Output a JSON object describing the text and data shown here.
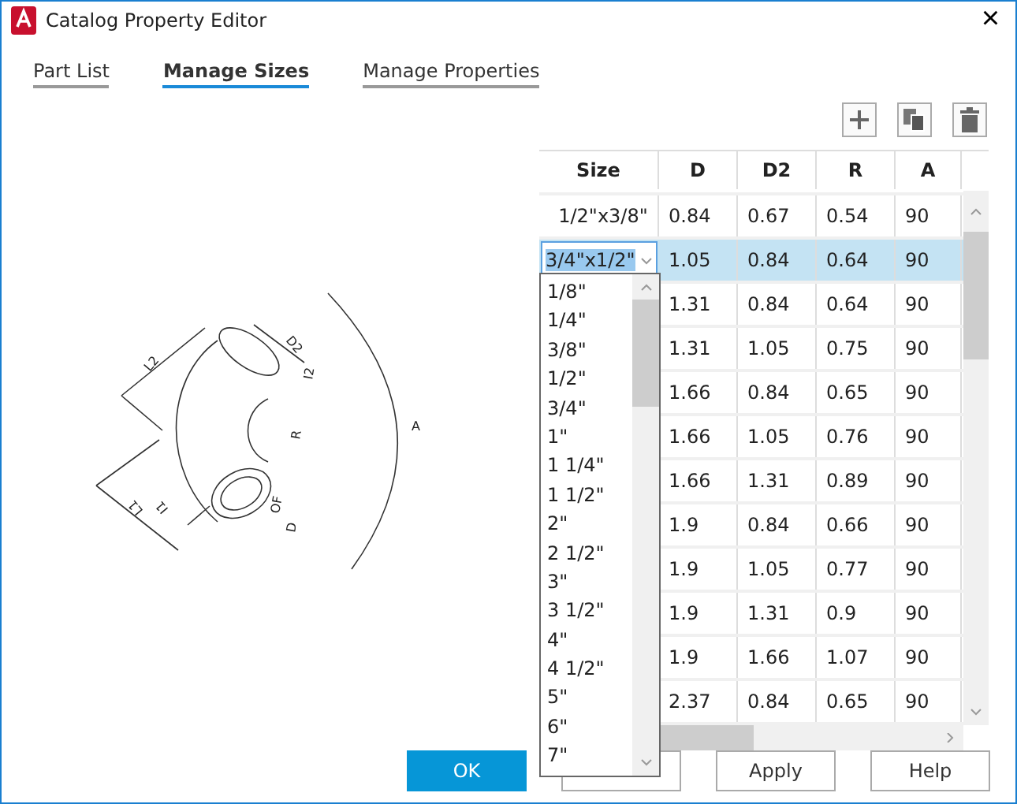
{
  "window": {
    "title": "Catalog Property Editor",
    "close": "×"
  },
  "tabs": [
    {
      "label": "Part List",
      "selected": false
    },
    {
      "label": "Manage Sizes",
      "selected": true
    },
    {
      "label": "Manage Properties",
      "selected": false
    }
  ],
  "diagram_labels": [
    "L2",
    "D2",
    "I2",
    "R",
    "A",
    "L1",
    "I1",
    "OF",
    "D"
  ],
  "table": {
    "columns": [
      "Size",
      "D",
      "D2",
      "R",
      "A"
    ],
    "rows": [
      {
        "cells": [
          "1/2\"x3/8\"",
          "0.84",
          "0.67",
          "0.54",
          "90"
        ],
        "selected": false
      },
      {
        "cells": [
          "3/4\"x1/2\"",
          "1.05",
          "0.84",
          "0.64",
          "90"
        ],
        "selected": true
      },
      {
        "cells": [
          "",
          "1.31",
          "0.84",
          "0.64",
          "90"
        ],
        "selected": false
      },
      {
        "cells": [
          "",
          "1.31",
          "1.05",
          "0.75",
          "90"
        ],
        "selected": false
      },
      {
        "cells": [
          "",
          "1.66",
          "0.84",
          "0.65",
          "90"
        ],
        "selected": false
      },
      {
        "cells": [
          "",
          "1.66",
          "1.05",
          "0.76",
          "90"
        ],
        "selected": false
      },
      {
        "cells": [
          "",
          "1.66",
          "1.31",
          "0.89",
          "90"
        ],
        "selected": false
      },
      {
        "cells": [
          "",
          "1.9",
          "0.84",
          "0.66",
          "90"
        ],
        "selected": false
      },
      {
        "cells": [
          "",
          "1.9",
          "1.05",
          "0.77",
          "90"
        ],
        "selected": false
      },
      {
        "cells": [
          "",
          "1.9",
          "1.31",
          "0.9",
          "90"
        ],
        "selected": false
      },
      {
        "cells": [
          "",
          "1.9",
          "1.66",
          "1.07",
          "90"
        ],
        "selected": false
      },
      {
        "cells": [
          "",
          "2.37",
          "0.84",
          "0.65",
          "90"
        ],
        "selected": false
      }
    ]
  },
  "size_dropdown": {
    "options": [
      "1/8\"",
      "1/4\"",
      "3/8\"",
      "1/2\"",
      "3/4\"",
      "1\"",
      "1 1/4\"",
      "1 1/2\"",
      "2\"",
      "2 1/2\"",
      "3\"",
      "3 1/2\"",
      "4\"",
      "4 1/2\"",
      "5\"",
      "6\"",
      "7\""
    ]
  },
  "buttons": [
    {
      "label": "OK",
      "kind": "primary"
    },
    {
      "kind": "hidden"
    },
    {
      "label": "Apply",
      "kind": "normal"
    },
    {
      "label": "Help",
      "kind": "normal"
    }
  ]
}
